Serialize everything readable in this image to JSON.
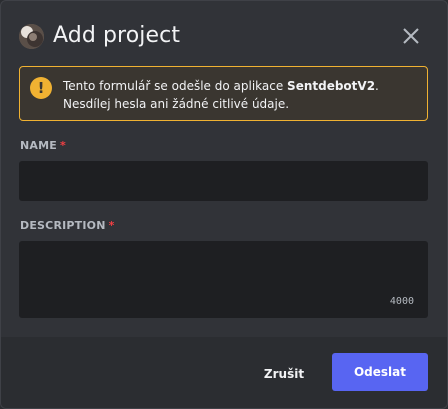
{
  "dialog": {
    "title": "Add project",
    "avatar_icon": "app-avatar-icon",
    "close_icon": "close-icon"
  },
  "warning": {
    "icon": "warning-icon",
    "icon_glyph": "!",
    "text_before": "Tento formulář se odešle do aplikace ",
    "app_name": "SentdebotV2",
    "text_after": ". Nesdílej hesla ani žádné citlivé údaje.",
    "color": "#f0b232"
  },
  "fields": {
    "name": {
      "label": "NAME",
      "required_mark": "*",
      "value": ""
    },
    "description": {
      "label": "DESCRIPTION",
      "required_mark": "*",
      "value": "",
      "char_limit": "4000"
    }
  },
  "footer": {
    "cancel_label": "Zrušit",
    "submit_label": "Odeslat",
    "accent": "#5865f2"
  }
}
